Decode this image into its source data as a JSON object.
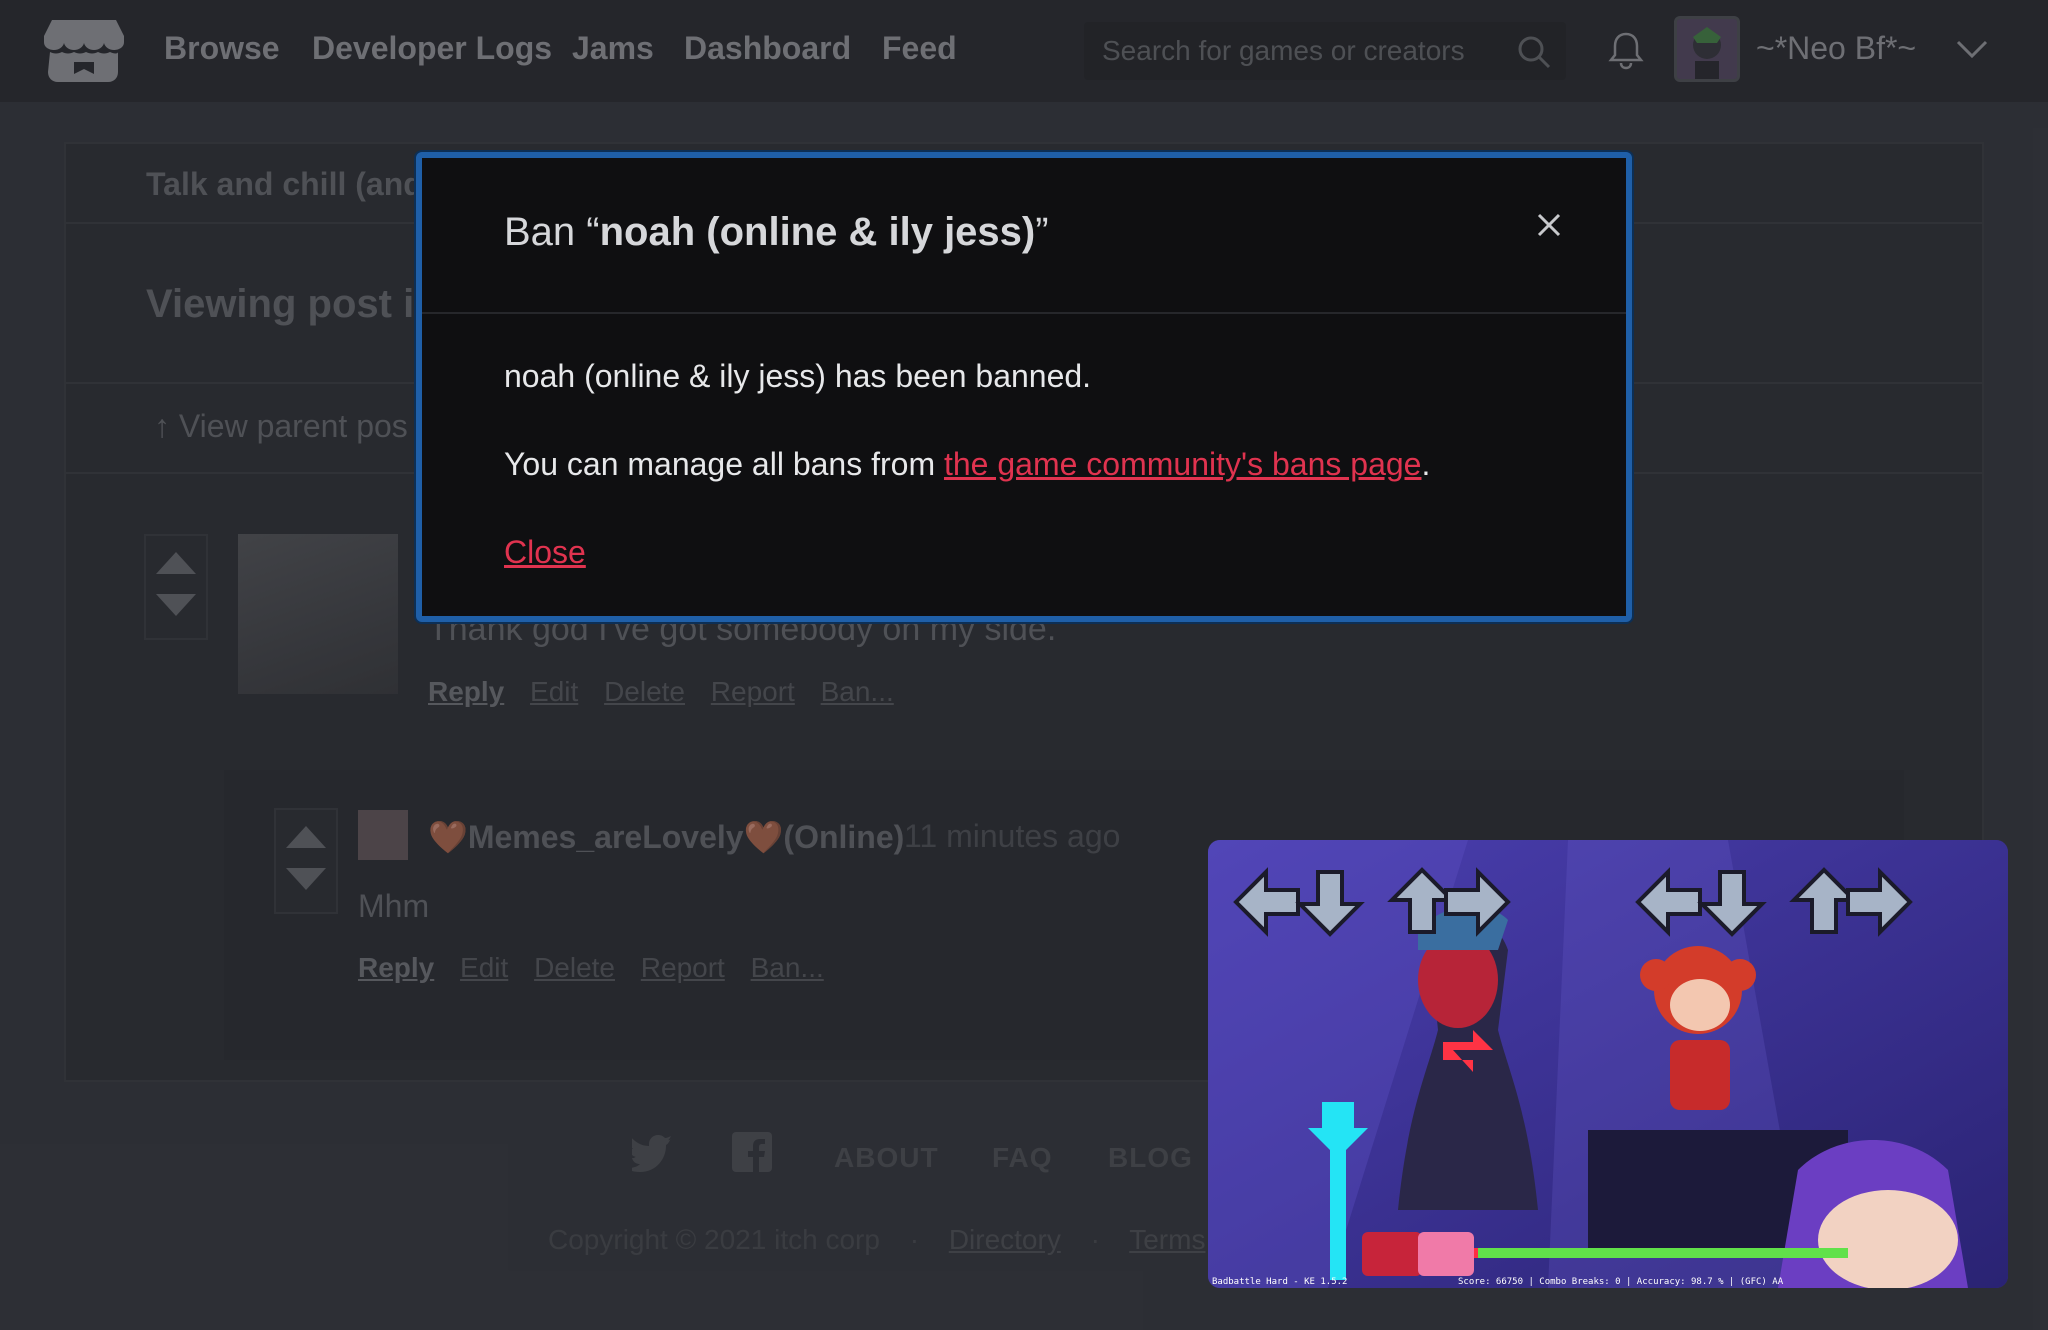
{
  "nav": {
    "items": [
      "Browse",
      "Developer Logs",
      "Jams",
      "Dashboard",
      "Feed"
    ],
    "search_placeholder": "Search for games or creators",
    "username": "~*Neo Bf*~"
  },
  "page": {
    "breadcrumb": "Talk and chill (and r",
    "viewing_title": "Viewing post ir",
    "parent_link": "↑ View parent pos"
  },
  "post": {
    "body": "Thank god I've got somebody on my side.",
    "actions": [
      "Reply",
      "Edit",
      "Delete",
      "Report",
      "Ban..."
    ]
  },
  "reply": {
    "username": "🤎Memes_areLovely🤎(Online)",
    "time": "11 minutes ago",
    "text": "Mhm",
    "actions": [
      "Reply",
      "Edit",
      "Delete",
      "Report",
      "Ban..."
    ]
  },
  "footer": {
    "links": [
      "ABOUT",
      "FAQ",
      "BLOG"
    ],
    "copyright": "Copyright © 2021 itch corp",
    "directory": "Directory",
    "terms": "Terms",
    "sep": "·"
  },
  "modal": {
    "title_prefix": "Ban “",
    "title_name": "noah (online & ily jess)",
    "title_suffix": "”",
    "message": "noah (online & ily jess) has been banned.",
    "manage_prefix": "You can manage all bans from ",
    "manage_link": "the game community's bans page",
    "manage_suffix": ".",
    "close_label": "Close"
  },
  "video": {
    "hud_left": "Badbattle Hard - KE 1.5.2",
    "hud_right": "Score: 66750 | Combo Breaks: 0 | Accuracy: 98.7 % | (GFC) AA"
  },
  "colors": {
    "accent": "#e0334f",
    "modal_border": "#1f5fa8"
  }
}
